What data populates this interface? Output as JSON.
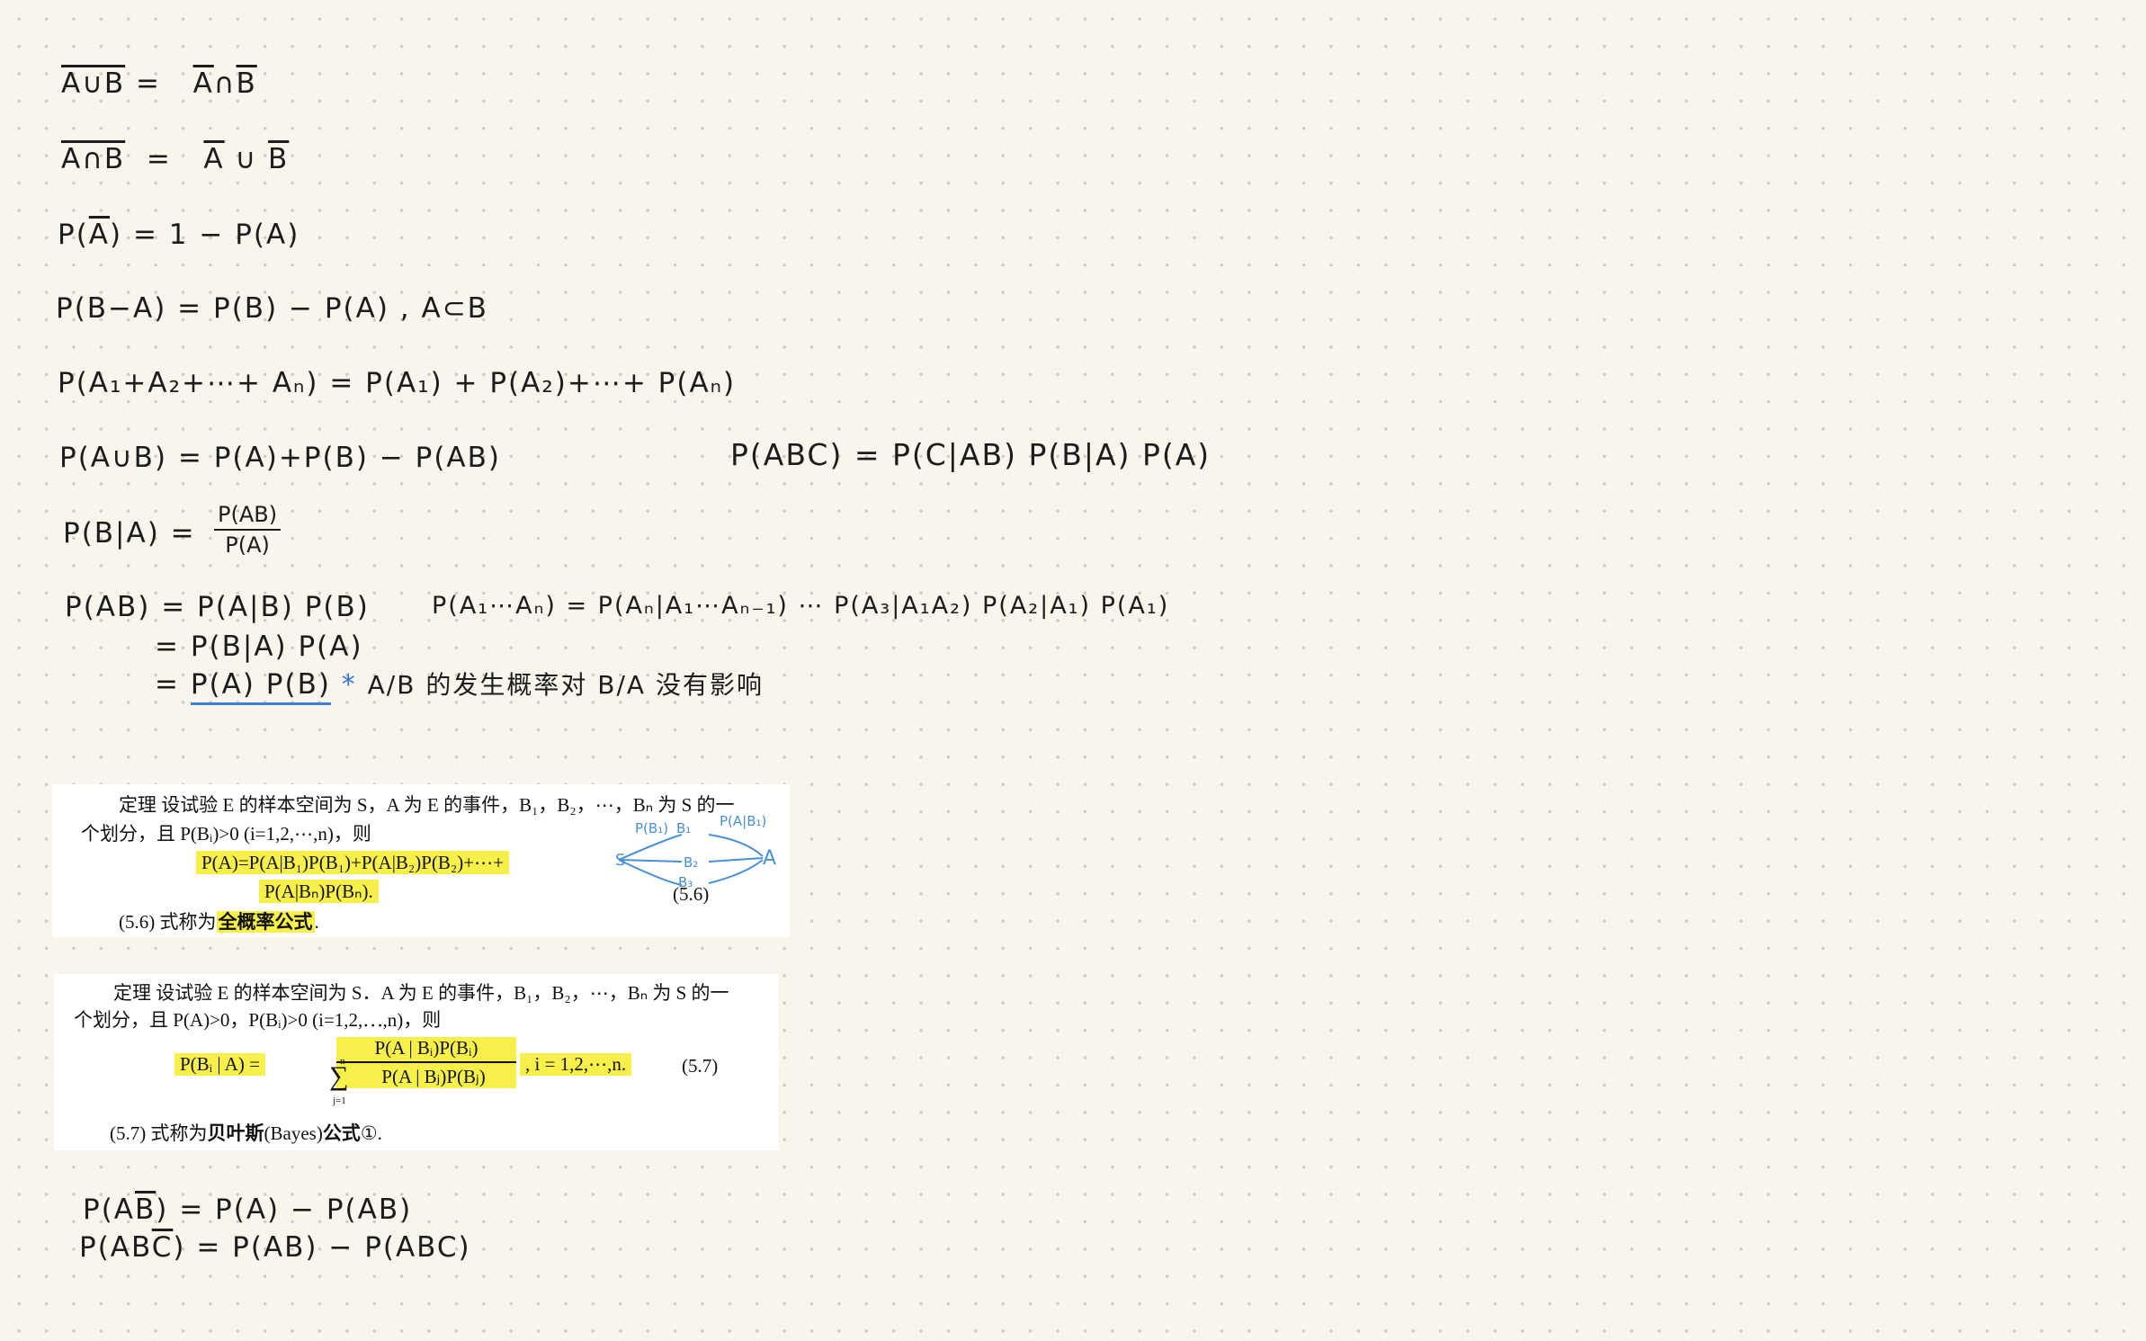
{
  "formulas": {
    "demorgan1_lhs": "A∪B",
    "demorgan1_rhs_a": "A",
    "demorgan1_rhs_b": "B",
    "demorgan2_lhs": "A∩B",
    "demorgan2_rhs_a": "A",
    "demorgan2_rhs_b": "B",
    "complement_lhs_pre": "P(",
    "complement_lhs_a": "A",
    "complement_rhs": ") = 1 −  P(A)",
    "difference": "P(B−A) =  P(B) − P(A)    ,   A⊂B",
    "additivity": "P(A₁+A₂+⋯+ Aₙ)  =   P(A₁) + P(A₂)+⋯+ P(Aₙ)",
    "union": "P(A∪B) =  P(A)+P(B) −  P(AB)",
    "chain_three": "P(ABC) = P(C|AB) P(B|A) P(A)",
    "conditional_lhs": "P(B|A) =",
    "conditional_num": "P(AB)",
    "conditional_den": "P(A)",
    "mult_line1": "P(AB) = P(A|B) P(B)",
    "mult_line2": "= P(B|A) P(A)",
    "mult_line3_eq": "=",
    "mult_line3_indep": "P(A) P(B)",
    "mult_star": "*",
    "mult_note": "A/B 的发生概率对 B/A 没有影响",
    "chain_general": "P(A₁⋯Aₙ) = P(Aₙ|A₁⋯Aₙ₋₁) ⋯ P(A₃|A₁A₂) P(A₂|A₁) P(A₁)",
    "bottom1_pre": "P(A",
    "bottom1_bar": "B",
    "bottom1_post": ") =  P(A) − P(AB)",
    "bottom2_pre": "P(AB",
    "bottom2_bar": "C",
    "bottom2_post": ") = P(AB) −  P(ABC)"
  },
  "clip_total_prob": {
    "line1": "定理   设试验 E 的样本空间为 S，A 为 E 的事件，B₁，B₂，⋯，Bₙ 为 S 的一",
    "line2": "个划分，且 P(Bᵢ)>0 (i=1,2,⋯,n)，则",
    "formula1": "P(A)=P(A|B₁)P(B₁)+P(A|B₂)P(B₂)+⋯+",
    "formula2": "P(A|Bₙ)P(Bₙ).",
    "eqno": "(5.6)",
    "caption_pre": "(5.6) 式称为",
    "caption_bold": "全概率公式",
    "caption_post": ".",
    "sketch_s": "S",
    "sketch_pb1": "P(B₁)",
    "sketch_b1": "B₁",
    "sketch_b2": "B₂",
    "sketch_b3": "B₃",
    "sketch_pab1": "P(A|B₁)",
    "sketch_a": "A"
  },
  "clip_bayes": {
    "line1": "定理   设试验 E 的样本空间为 S．A 为 E 的事件，B₁，B₂，⋯，Bₙ 为 S 的一",
    "line2": "个划分，且 P(A)>0，P(Bᵢ)>0 (i=1,2,⋯,n)，则",
    "lhs": "P(Bᵢ | A) =",
    "num": "P(A | Bᵢ)P(Bᵢ)",
    "den": "P(A | Bⱼ)P(Bⱼ)",
    "sum_top": "n",
    "sum_bottom": "j=1",
    "range": ",   i = 1,2,⋯,n.",
    "eqno": "(5.7)",
    "caption_pre": "(5.7) 式称为",
    "caption_bold": "贝叶斯",
    "caption_mid": "(Bayes)",
    "caption_bold2": "公式",
    "caption_post": "①."
  },
  "colors": {
    "background": "#f8f6ec",
    "highlight": "#f7f04a",
    "ink": "#1c1c1c",
    "annotation_blue": "#2f77d0"
  }
}
